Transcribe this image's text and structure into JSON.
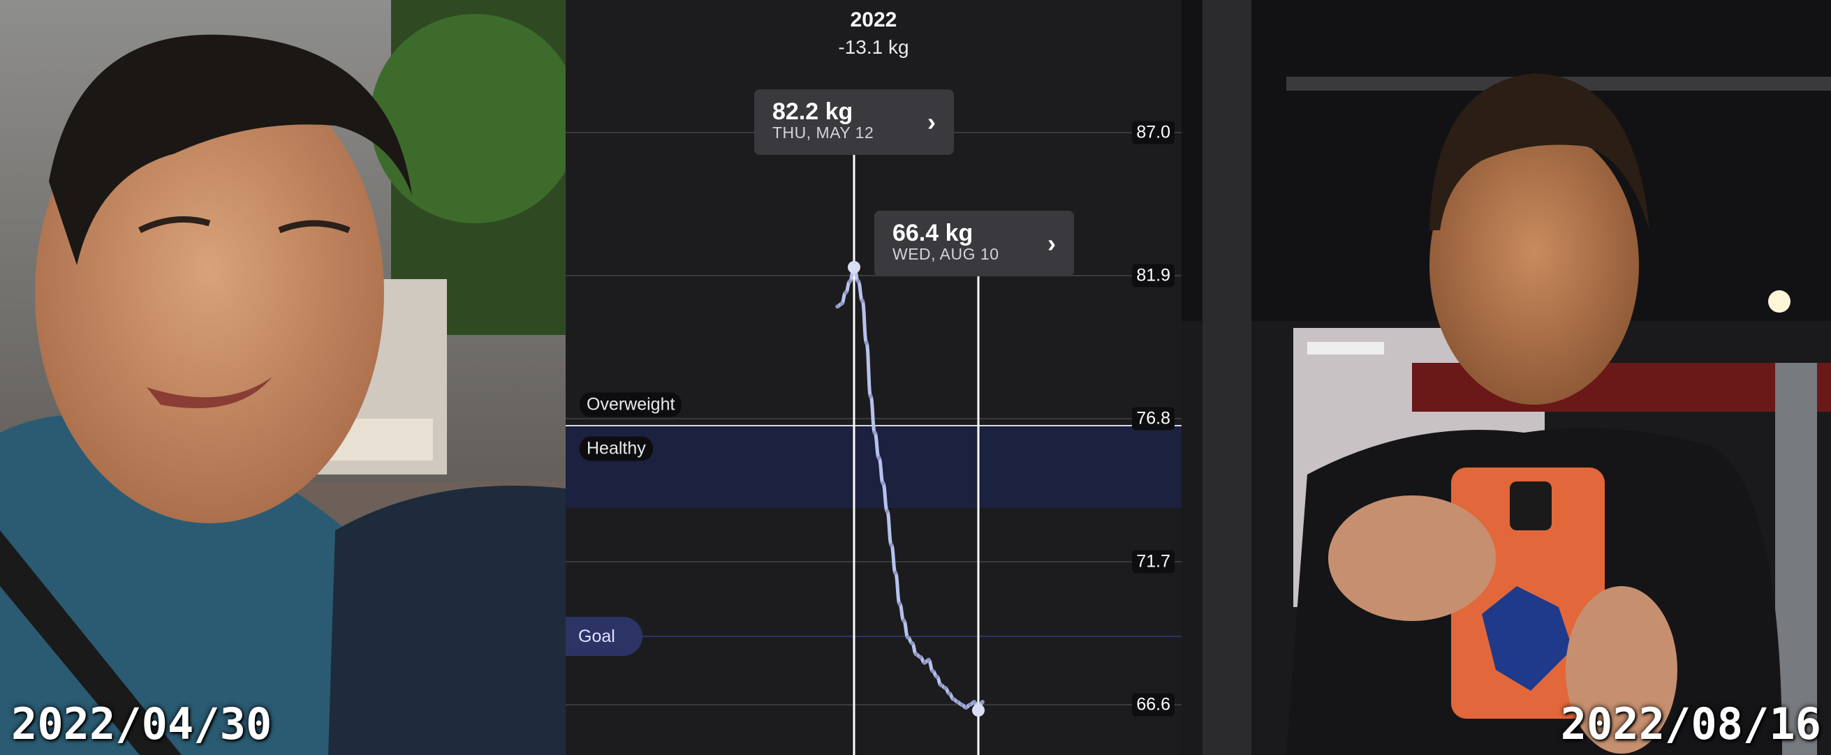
{
  "left_photo": {
    "date": "2022/04/30"
  },
  "right_photo": {
    "date": "2022/08/16"
  },
  "chart": {
    "year": "2022",
    "change": "-13.1 kg",
    "zones": {
      "overweight": "Overweight",
      "healthy": "Healthy",
      "goal": "Goal"
    },
    "y_labels": [
      "87.0",
      "81.9",
      "76.8",
      "71.7",
      "66.6"
    ],
    "tooltips": [
      {
        "weight": "82.2 kg",
        "date": "THU, MAY 12",
        "icon": "chevron-right-icon"
      },
      {
        "weight": "66.4 kg",
        "date": "WED, AUG 10",
        "icon": "chevron-right-icon"
      }
    ],
    "colors": {
      "line": "#b8c2ee",
      "healthy_band": "#1c2140",
      "goal_line": "#2c3466",
      "background": "#1c1c1e"
    }
  },
  "chart_data": {
    "type": "line",
    "title": "2022",
    "subtitle": "-13.1 kg",
    "ylabel": "",
    "xlabel": "",
    "ylim": [
      64.6,
      90.1
    ],
    "yticks": [
      87.0,
      81.9,
      76.8,
      71.7,
      66.6
    ],
    "zones": [
      {
        "name": "Overweight",
        "above": 76.8
      },
      {
        "name": "Healthy",
        "from": 73.3,
        "to": 76.8
      },
      {
        "name": "Goal",
        "value": 69.0
      }
    ],
    "series": [
      {
        "x": [
          "2022-04-30",
          "2022-05-03",
          "2022-05-06",
          "2022-05-09",
          "2022-05-12",
          "2022-05-15",
          "2022-05-18",
          "2022-05-21",
          "2022-05-24",
          "2022-05-27",
          "2022-05-30",
          "2022-06-02",
          "2022-06-05",
          "2022-06-08",
          "2022-06-11",
          "2022-06-14",
          "2022-06-17",
          "2022-06-20",
          "2022-06-23",
          "2022-06-26",
          "2022-06-29",
          "2022-07-02",
          "2022-07-05",
          "2022-07-08",
          "2022-07-11",
          "2022-07-14",
          "2022-07-17",
          "2022-07-20",
          "2022-07-23",
          "2022-07-26",
          "2022-07-29",
          "2022-08-01",
          "2022-08-04",
          "2022-08-07",
          "2022-08-10",
          "2022-08-13"
        ],
        "values": [
          80.8,
          80.9,
          81.3,
          81.7,
          82.2,
          81.7,
          81.0,
          79.5,
          77.6,
          76.3,
          75.4,
          74.5,
          73.5,
          72.3,
          71.3,
          70.2,
          69.6,
          69.0,
          68.8,
          68.4,
          68.3,
          68.1,
          68.2,
          67.8,
          67.6,
          67.3,
          67.2,
          67.0,
          66.8,
          66.7,
          66.6,
          66.5,
          66.6,
          66.7,
          66.4,
          66.7
        ]
      }
    ],
    "points": [
      {
        "x": "2022-05-12",
        "y": 82.2
      },
      {
        "x": "2022-08-10",
        "y": 66.4
      }
    ]
  }
}
